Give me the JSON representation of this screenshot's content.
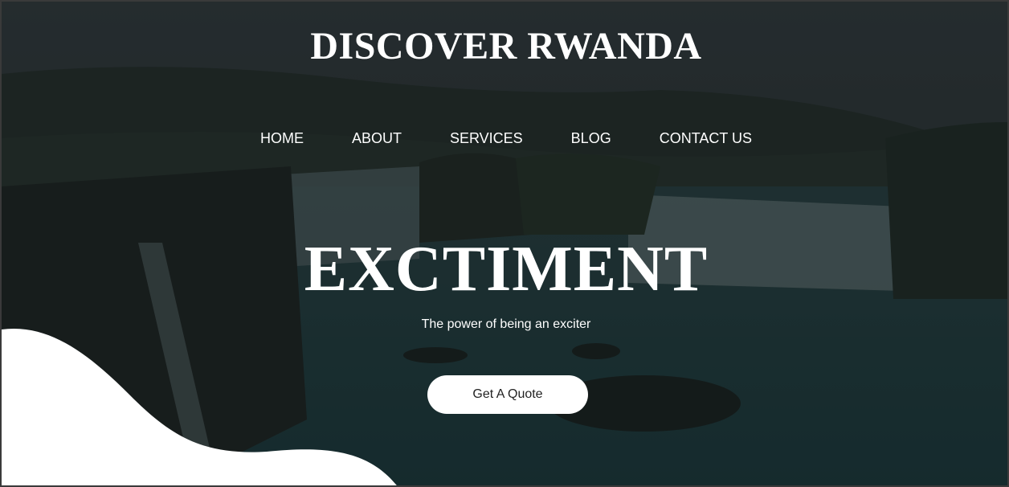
{
  "header": {
    "brand": "DISCOVER RWANDA"
  },
  "nav": {
    "items": [
      "HOME",
      "ABOUT",
      "SERVICES",
      "BLOG",
      "CONTACT US"
    ]
  },
  "hero": {
    "headline": "EXCTIMENT",
    "tagline": "The power of being an exciter",
    "cta_label": "Get A Quote"
  },
  "colors": {
    "text": "#ffffff",
    "button_bg": "#ffffff",
    "button_text": "#222222",
    "overlay": "#0a1012"
  }
}
